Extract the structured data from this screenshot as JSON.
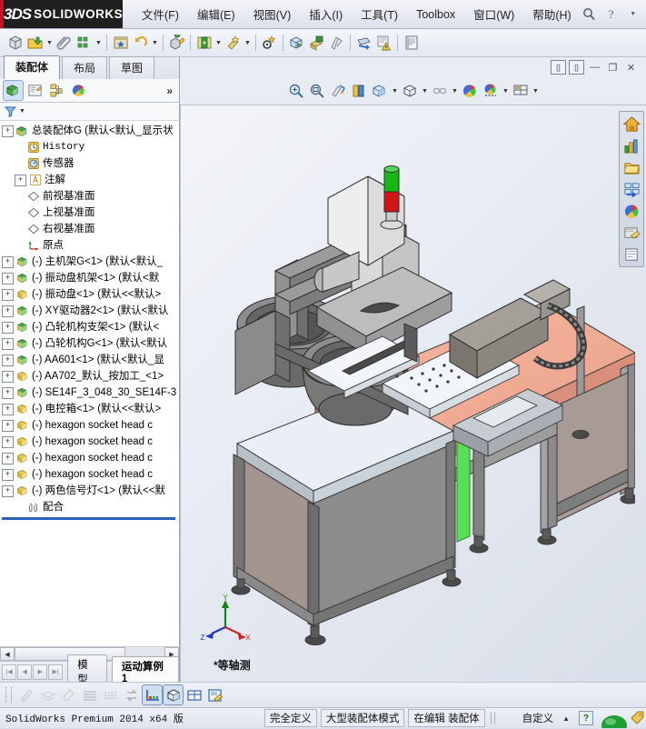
{
  "app": {
    "brand_ds": "3DS",
    "brand_name": "SOLIDWORKS",
    "version_text": "SolidWorks Premium 2014 x64 版"
  },
  "menu": {
    "items": [
      {
        "label": "文件(F)",
        "name": "menu-file"
      },
      {
        "label": "编辑(E)",
        "name": "menu-edit"
      },
      {
        "label": "视图(V)",
        "name": "menu-view"
      },
      {
        "label": "插入(I)",
        "name": "menu-insert"
      },
      {
        "label": "工具(T)",
        "name": "menu-tools"
      },
      {
        "label": "Toolbox",
        "name": "menu-toolbox"
      },
      {
        "label": "窗口(W)",
        "name": "menu-window"
      },
      {
        "label": "帮助(H)",
        "name": "menu-help"
      }
    ],
    "search_icon": "search-icon",
    "help_icon": "help-icon",
    "dropdown_icon": "chevron-down-icon",
    "minimize": "—",
    "maximize": "❐",
    "close": "✕"
  },
  "toolbar": {
    "icons": [
      {
        "name": "new-document-icon"
      },
      {
        "name": "open-document-icon",
        "caret": true
      },
      {
        "name": "attach-paperclip-icon"
      },
      {
        "name": "rebuild-icon",
        "caret": true
      },
      {
        "name": "options-star-icon"
      },
      {
        "name": "undo-icon",
        "caret": true
      },
      {
        "name": "edit-component-icon"
      },
      {
        "name": "insert-component-icon",
        "caret": true
      },
      {
        "name": "mate-icon",
        "caret": true
      },
      {
        "name": "smart-fasteners-icon"
      },
      {
        "name": "exploded-view-icon"
      },
      {
        "name": "assembly-features-icon"
      },
      {
        "name": "reference-geometry-icon"
      },
      {
        "name": "move-component-icon"
      },
      {
        "name": "interference-detection-icon"
      },
      {
        "name": "bom-icon"
      }
    ]
  },
  "panel": {
    "manager_tabs": [
      {
        "label": "装配体",
        "name": "tab-assembly",
        "active": true
      },
      {
        "label": "布局",
        "name": "tab-layout",
        "active": false
      },
      {
        "label": "草图",
        "name": "tab-sketch",
        "active": false
      }
    ],
    "manager_icons": [
      {
        "name": "feature-manager-tree-icon",
        "selected": true
      },
      {
        "name": "property-manager-icon",
        "selected": false
      },
      {
        "name": "configuration-manager-icon",
        "selected": false
      },
      {
        "name": "display-manager-icon",
        "selected": false
      }
    ],
    "expand_chevron": "»",
    "filter_icon": "filter-icon",
    "filter_caret": "chevron-down-icon"
  },
  "tree": {
    "root": {
      "label": "总装配体G  (默认<默认_显示状",
      "icon": "assembly-icon",
      "expandable": true
    },
    "nodes": [
      {
        "label": "History",
        "icon": "history-icon",
        "mono": true,
        "plus": false,
        "indent": 1
      },
      {
        "label": "传感器",
        "icon": "sensor-icon",
        "mono": false,
        "plus": false,
        "indent": 1
      },
      {
        "label": "注解",
        "icon": "annotations-icon",
        "mono": false,
        "plus": true,
        "indent": 1
      },
      {
        "label": "前视基准面",
        "icon": "plane-icon",
        "mono": false,
        "plus": false,
        "indent": 1
      },
      {
        "label": "上视基准面",
        "icon": "plane-icon",
        "mono": false,
        "plus": false,
        "indent": 1
      },
      {
        "label": "右视基准面",
        "icon": "plane-icon",
        "mono": false,
        "plus": false,
        "indent": 1
      },
      {
        "label": "原点",
        "icon": "origin-icon",
        "mono": false,
        "plus": false,
        "indent": 1
      },
      {
        "label": "(-) 主机架G<1>  (默认<默认_",
        "icon": "part-green-icon",
        "mono": false,
        "plus": true,
        "indent": 0
      },
      {
        "label": "(-) 振动盘机架<1>  (默认<默",
        "icon": "part-green-icon",
        "mono": false,
        "plus": true,
        "indent": 0
      },
      {
        "label": "(-) 振动盘<1>  (默认<<默认>",
        "icon": "part-yellow-icon",
        "mono": false,
        "plus": true,
        "indent": 0
      },
      {
        "label": "(-) XY驱动器2<1>  (默认<默认",
        "icon": "part-green-icon",
        "mono": false,
        "plus": true,
        "indent": 0
      },
      {
        "label": "(-) 凸轮机构支架<1>  (默认<",
        "icon": "part-green-icon",
        "mono": false,
        "plus": true,
        "indent": 0
      },
      {
        "label": "(-) 凸轮机构G<1>  (默认<默认",
        "icon": "part-green-icon",
        "mono": false,
        "plus": true,
        "indent": 0
      },
      {
        "label": "(-) AA601<1>  (默认<默认_显",
        "icon": "part-green-icon",
        "mono": false,
        "plus": true,
        "indent": 0
      },
      {
        "label": "(-) AA702_默认_按加工_<1>",
        "icon": "part-yellow-icon",
        "mono": false,
        "plus": true,
        "indent": 0
      },
      {
        "label": "(-) SE14F_3_048_30_SE14F-3",
        "icon": "part-green-icon",
        "mono": false,
        "plus": true,
        "indent": 0
      },
      {
        "label": "(-) 电控箱<1>  (默认<<默认>",
        "icon": "part-yellow-icon",
        "mono": false,
        "plus": true,
        "indent": 0
      },
      {
        "label": "(-) hexagon socket head c",
        "icon": "part-yellow-icon",
        "mono": false,
        "plus": true,
        "indent": 0
      },
      {
        "label": "(-) hexagon socket head c",
        "icon": "part-yellow-icon",
        "mono": false,
        "plus": true,
        "indent": 0
      },
      {
        "label": "(-) hexagon socket head c",
        "icon": "part-yellow-icon",
        "mono": false,
        "plus": true,
        "indent": 0
      },
      {
        "label": "(-) hexagon socket head c",
        "icon": "part-yellow-icon",
        "mono": false,
        "plus": true,
        "indent": 0
      },
      {
        "label": "(-) 两色信号灯<1>  (默认<<默",
        "icon": "part-yellow-icon",
        "mono": false,
        "plus": true,
        "indent": 0
      },
      {
        "label": "配合",
        "icon": "mates-folder-icon",
        "mono": false,
        "plus": false,
        "indent": 1
      }
    ]
  },
  "tree_footer": {
    "nav_buttons": [
      "first-record-icon",
      "prev-record-icon",
      "next-record-icon",
      "last-record-icon"
    ],
    "tabs": [
      {
        "label": "模型",
        "name": "tab-model",
        "active": false
      },
      {
        "label": "运动算例 1",
        "name": "tab-motion-study",
        "active": true
      }
    ],
    "scroll_left": "◀",
    "scroll_right": "▶"
  },
  "graphics": {
    "doc_buttons": [
      "restore-doc-icon",
      "restore-doc2-icon"
    ],
    "window_buttons": [
      "minimize-doc-icon",
      "restore-window-icon",
      "close-doc-icon"
    ],
    "view_toolbar": [
      {
        "name": "zoom-to-fit-icon"
      },
      {
        "name": "zoom-to-area-icon"
      },
      {
        "name": "previous-view-icon"
      },
      {
        "name": "section-view-icon"
      },
      {
        "name": "view-orientation-icon",
        "caret": true
      },
      {
        "name": "display-style-icon",
        "caret": true
      },
      {
        "name": "hide-show-items-icon",
        "caret": true
      },
      {
        "name": "apply-scene-icon"
      },
      {
        "name": "view-settings-icon",
        "caret": true
      },
      {
        "name": "viewport-icon",
        "caret": true
      }
    ],
    "side_toolbar": [
      {
        "name": "home-icon"
      },
      {
        "name": "solidworks-resources-icon"
      },
      {
        "name": "design-library-icon"
      },
      {
        "name": "file-explorer-icon"
      },
      {
        "name": "view-palette-icon"
      },
      {
        "name": "appearances-scenes-icon"
      },
      {
        "name": "custom-properties-icon"
      }
    ],
    "view_label": "*等轴测",
    "triad": {
      "x": "X",
      "y": "Y",
      "z": "Z",
      "x_color": "#cc2222",
      "y_color": "#118811",
      "z_color": "#2233cc"
    },
    "model_colors": {
      "tabletop": "#f0a990",
      "frame": "#8f8f8f",
      "frame_dark": "#6b6b6b",
      "panel": "#a39590",
      "plate": "#e8eef2",
      "green_panel": "#4fd84f",
      "lamp_green": "#14b814",
      "lamp_red": "#d41414",
      "bowl": "#707070",
      "edge": "#303030"
    }
  },
  "lower_toolbar": {
    "icons": [
      {
        "name": "edit-sketch-icon",
        "on": false,
        "disabled": true
      },
      {
        "name": "layers-icon",
        "on": false,
        "disabled": true
      },
      {
        "name": "paint-icon",
        "on": false,
        "disabled": true
      },
      {
        "name": "line-format-icon",
        "on": false,
        "disabled": true
      },
      {
        "name": "hidden-lines-icon",
        "on": false,
        "disabled": true
      },
      {
        "name": "toggle-direction-icon",
        "on": false,
        "disabled": true
      },
      {
        "name": "coordinate-display-icon",
        "on": true,
        "disabled": false
      },
      {
        "name": "shaded-view-icon",
        "on": true,
        "disabled": false
      },
      {
        "name": "table-icon",
        "on": false,
        "disabled": false
      },
      {
        "name": "note-icon",
        "on": false,
        "disabled": false
      }
    ]
  },
  "statusbar": {
    "version": "SolidWorks Premium 2014 x64 版",
    "cells": [
      "完全定义",
      "大型装配体模式",
      "在编辑  装配体"
    ],
    "customize": "自定义",
    "up_arrow": "▲",
    "help_badge": "?",
    "sphere_icon": "green-sphere-icon",
    "tag_icon": "tag-icon"
  }
}
